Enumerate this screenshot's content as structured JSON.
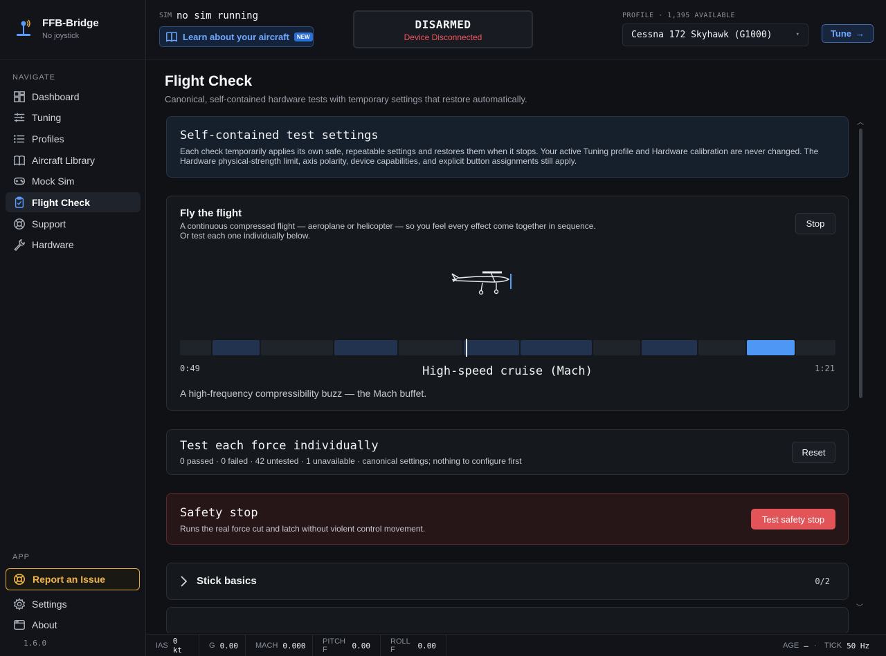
{
  "app": {
    "name": "FFB-Bridge",
    "device": "No joystick",
    "version": "1.6.0"
  },
  "sidebar": {
    "navigate_label": "NAVIGATE",
    "items": [
      {
        "label": "Dashboard",
        "icon": "dashboard-icon"
      },
      {
        "label": "Tuning",
        "icon": "sliders-icon"
      },
      {
        "label": "Profiles",
        "icon": "list-icon"
      },
      {
        "label": "Aircraft Library",
        "icon": "book-icon"
      },
      {
        "label": "Mock Sim",
        "icon": "gamepad-icon"
      },
      {
        "label": "Flight Check",
        "icon": "clipboard-check-icon",
        "active": true
      },
      {
        "label": "Support",
        "icon": "lifebuoy-icon"
      },
      {
        "label": "Hardware",
        "icon": "wrench-icon"
      }
    ],
    "app_label": "APP",
    "report": "Report an Issue",
    "settings": "Settings",
    "about": "About"
  },
  "topbar": {
    "sim_label": "SIM",
    "sim_status": "no sim running",
    "learn": "Learn about your aircraft",
    "learn_badge": "NEW",
    "arm_state": "DISARMED",
    "device_status": "Device Disconnected",
    "profile_label": "PROFILE · 1,395 AVAILABLE",
    "profile_value": "Cessna 172 Skyhawk (G1000)",
    "tune": "Tune"
  },
  "page": {
    "title": "Flight Check",
    "subtitle": "Canonical, self-contained hardware tests with temporary settings that restore automatically."
  },
  "settings_card": {
    "title": "Self-contained test settings",
    "text": "Each check temporarily applies its own safe, repeatable settings and restores them when it stops. Your active Tuning profile and Hardware calibration are never changed. The Hardware physical-strength limit, axis polarity, device capabilities, and explicit button assignments still apply."
  },
  "fly": {
    "title": "Fly the flight",
    "desc1": "A continuous compressed flight — aeroplane or helicopter — so you feel every effect come together in sequence.",
    "desc2": "Or test each one individually below.",
    "stop": "Stop",
    "time_elapsed": "0:49",
    "time_total": "1:21",
    "phase": "High-speed cruise (Mach)",
    "phase_desc": "A high-frequency compressibility buzz — the Mach buffet.",
    "progress_fraction": 0.6
  },
  "individual": {
    "title": "Test each force individually",
    "stats": "0 passed · 0 failed · 42 untested · 1 unavailable · canonical settings; nothing to configure first",
    "reset": "Reset"
  },
  "safety": {
    "title": "Safety stop",
    "desc": "Runs the real force cut and latch without violent control movement.",
    "button": "Test safety stop"
  },
  "basics": {
    "title": "Stick basics",
    "count": "0/2"
  },
  "status": {
    "ias_label": "IAS",
    "ias": "0 kt",
    "g_label": "G",
    "g": "0.00",
    "mach_label": "MACH",
    "mach": "0.000",
    "pitch_label": "PITCH F",
    "pitch": "0.00",
    "roll_label": "ROLL F",
    "roll": "0.00",
    "age_label": "AGE",
    "age": "—",
    "tick_label": "TICK",
    "tick": "50 Hz"
  },
  "colors": {
    "accent": "#5b9cff",
    "danger": "#e25457",
    "warning": "#e8a93b"
  }
}
